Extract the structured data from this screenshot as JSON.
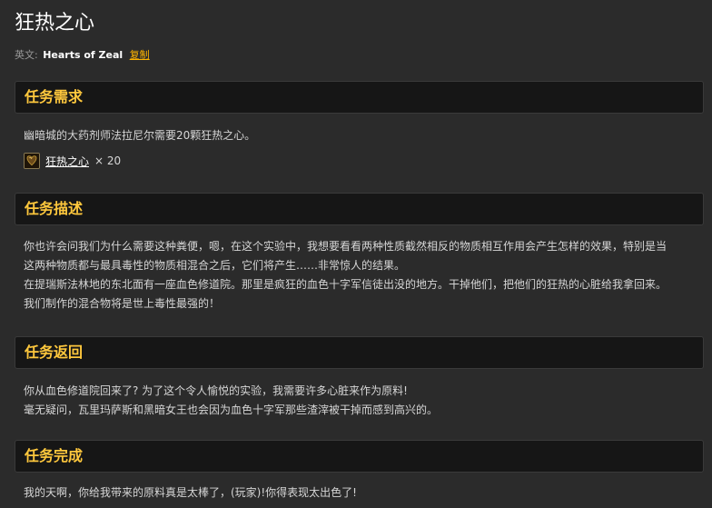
{
  "quest": {
    "title": "狂热之心",
    "english_label": "英文:",
    "english_name": "Hearts of Zeal",
    "copy_label": "复制"
  },
  "sections": {
    "requirements": {
      "heading": "任务需求",
      "text": "幽暗城的大药剂师法拉尼尔需要20颗狂热之心。",
      "item": {
        "name": "狂热之心",
        "count": "× 20",
        "icon": "heart-item-icon"
      }
    },
    "description": {
      "heading": "任务描述",
      "lines": [
        "你也许会问我们为什么需要这种粪便，嗯，在这个实验中，我想要看看两种性质截然相反的物质相互作用会产生怎样的效果，特别是当",
        "这两种物质都与最具毒性的物质相混合之后，它们将产生……非常惊人的结果。",
        "在提瑞斯法林地的东北面有一座血色修道院。那里是疯狂的血色十字军信徒出没的地方。干掉他们，把他们的狂热的心脏给我拿回来。",
        "我们制作的混合物将是世上毒性最强的！"
      ]
    },
    "return": {
      "heading": "任务返回",
      "lines": [
        "你从血色修道院回来了? 为了这个令人愉悦的实验，我需要许多心脏来作为原料!",
        "毫无疑问，瓦里玛萨斯和黑暗女王也会因为血色十字军那些渣滓被干掉而感到高兴的。"
      ]
    },
    "completion": {
      "heading": "任务完成",
      "lines": [
        "我的天啊，你给我带来的原料真是太棒了，(玩家)!你得表现太出色了!"
      ]
    }
  },
  "colors": {
    "background": "#2b2b2b",
    "header_bg": "#161616",
    "heading_text": "#ffc83d",
    "link_accent": "#ffb400"
  }
}
